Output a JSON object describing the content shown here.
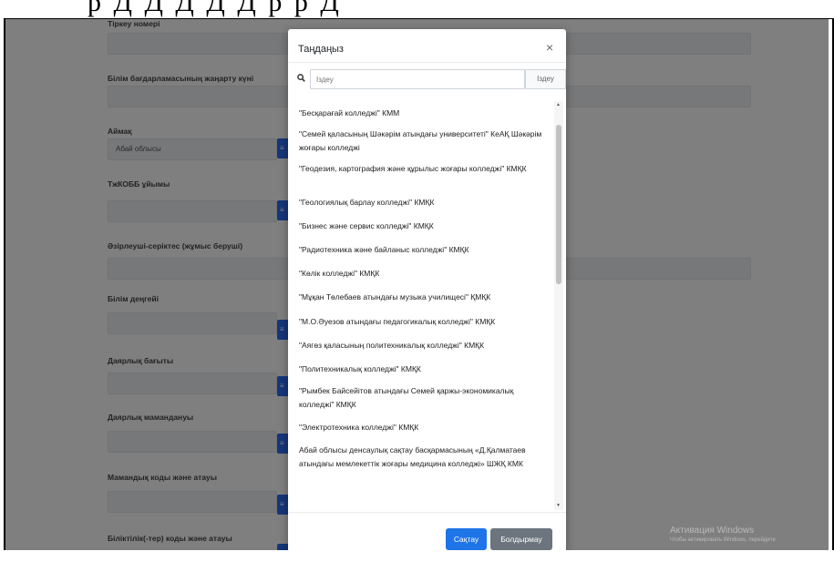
{
  "top_cut_text": "р Д Д Д Д Д р р Д",
  "form": {
    "fields": [
      {
        "label": "Тіркеу номері",
        "value": ""
      },
      {
        "label": "Білім бағдарламасының жаңарту күні",
        "value": ""
      },
      {
        "label": "Аймақ",
        "value": "Абай облысы"
      },
      {
        "label": "ТжКОББ ұйымы",
        "value": ""
      },
      {
        "label": "Әзірлеуші-серіктес (жұмыс беруші)",
        "value": ""
      },
      {
        "label": "Білім деңгейі",
        "value": ""
      },
      {
        "label": "Даярлық бағыты",
        "value": ""
      },
      {
        "label": "Даярлық мамандануы",
        "value": ""
      },
      {
        "label": "Мамандық коды және атауы",
        "value": ""
      },
      {
        "label": "Біліктілік(-тер) коды және атауы",
        "value": ""
      }
    ]
  },
  "modal": {
    "title": "Таңдаңыз",
    "close_icon": "×",
    "search": {
      "placeholder": "Іздеу",
      "button": "Іздеу",
      "icon": "search-icon"
    },
    "items": [
      "\"Бесқарағай колледжі\" КММ",
      "\"Семей қаласының Шәкәрім атындағы университеті\" КеАҚ Шәкәрім жоғары колледжі",
      "\"Геодезия, картография және құрылыс жоғары колледжі\" КМҚК",
      "\"Геологиялық барлау колледжі\" КМҚК",
      "\"Бизнес және сервис колледжі\" КМҚК",
      "\"Радиотехника және байланыс колледжі\" КМҚК",
      "\"Көлік колледжі\" КМҚК",
      "\"Мұқан Төлебаев атындағы музыка училищесі\" ҚМҚК",
      "\"М.О.Әуезов атындағы педагогикалық колледжі\" КМҚК",
      "\"Аягөз қаласының политехникалық колледжі\" КМҚК",
      "\"Политехникалық колледжі\" КМҚК",
      "\"Рымбек Байсейітов атындағы Семей қаржы-экономикалық колледжі\" КМҚК",
      "\"Электротехника колледжі\" КМҚК",
      "Абай облысы денсаулық сақтау басқармасының «Д.Қалматаев атындағы мемлекеттік жоғары медицина колледжі» ШЖҚ КМК"
    ],
    "save_label": "Сақтау",
    "cancel_label": "Болдырмау"
  },
  "watermark": {
    "line1": "Активация Windows",
    "line2": "Чтобы активировать Windows, перейдите"
  },
  "colors": {
    "primary": "#1f74e8",
    "secondary": "#6c757d",
    "overlay": "rgba(0,0,0,0.5)"
  }
}
